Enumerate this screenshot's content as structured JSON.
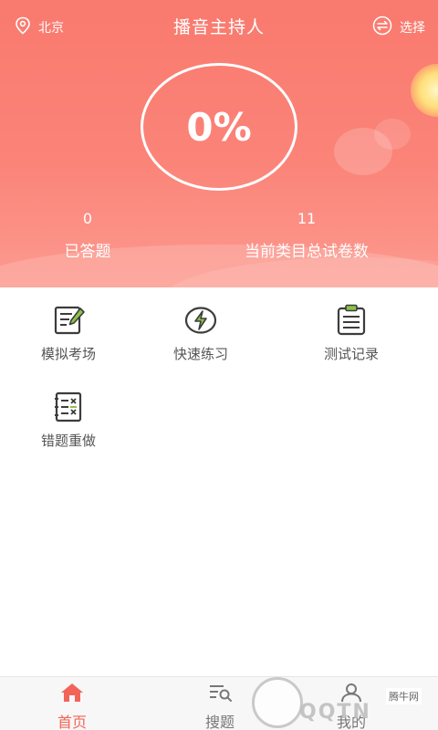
{
  "header": {
    "location": "北京",
    "title": "播音主持人",
    "select_label": "选择",
    "progress_text": "0%",
    "progress_value": 0,
    "answered_count": "0",
    "answered_label": "已答题",
    "total_papers_count": "11",
    "total_papers_label": "当前类目总试卷数"
  },
  "menu": [
    {
      "label": "模拟考场",
      "icon": "edit-paper-icon"
    },
    {
      "label": "快速练习",
      "icon": "lightning-icon"
    },
    {
      "label": "测试记录",
      "icon": "clipboard-icon"
    },
    {
      "label": "错题重做",
      "icon": "wrong-list-icon"
    }
  ],
  "tabbar": {
    "home": "首页",
    "search": "搜题",
    "mine": "我的"
  },
  "watermark": {
    "brand": "腾牛网",
    "text": "QQTN"
  },
  "colors": {
    "accent": "#f2645a",
    "header_top": "#f97a6e",
    "header_bottom": "#fc9a8f",
    "icon_dark": "#3c3c3c"
  }
}
